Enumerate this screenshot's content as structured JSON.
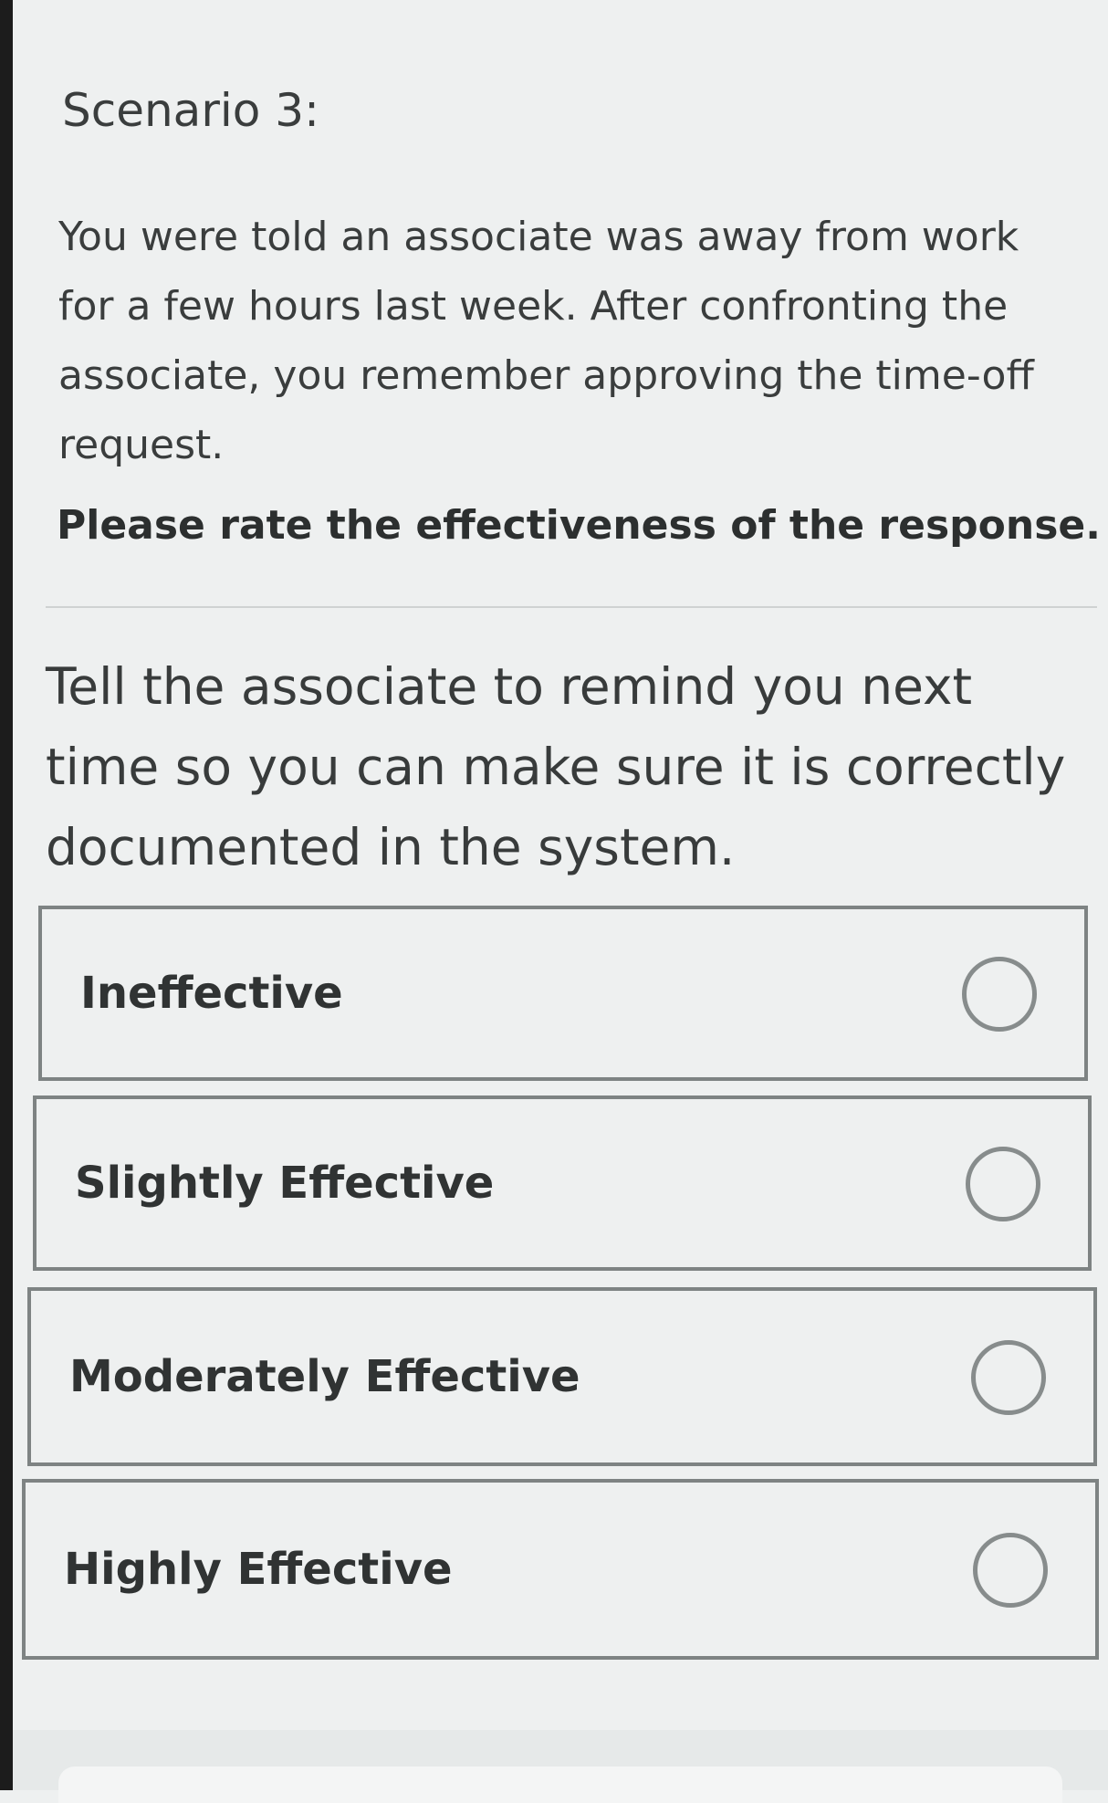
{
  "scenario": {
    "title": "Scenario 3:",
    "description": "You were told an associate was away from work for a few hours last week. After confronting the associate, you remember approving the time-off request.",
    "instruction": "Please rate the effectiveness of the response."
  },
  "response": {
    "text": "Tell the associate to remind you next time so you can make sure it is correctly documented in the system."
  },
  "options": [
    {
      "label": "Ineffective",
      "selected": false
    },
    {
      "label": "Slightly Effective",
      "selected": false
    },
    {
      "label": "Moderately Effective",
      "selected": false
    },
    {
      "label": "Highly Effective",
      "selected": false
    }
  ],
  "colors": {
    "background": "#eef0f0",
    "text": "#3a3d3d",
    "option_border": "#7e8383",
    "radio_border": "#878c8c"
  }
}
